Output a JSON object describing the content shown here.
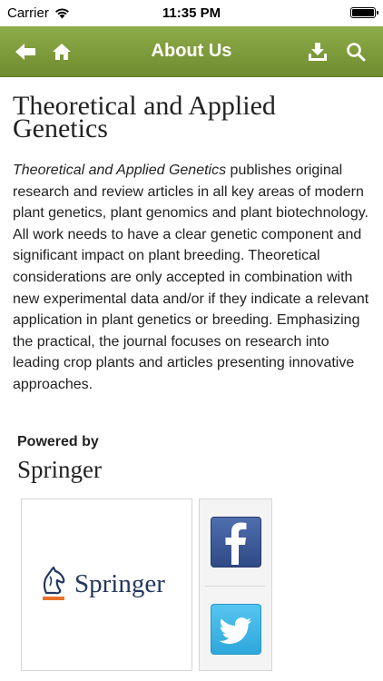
{
  "status_bar": {
    "carrier": "Carrier",
    "time": "11:35 PM"
  },
  "nav": {
    "title": "About Us",
    "icons": {
      "back": "back-arrow-icon",
      "home": "home-icon",
      "download": "download-icon",
      "search": "search-icon"
    },
    "color": "#7a9a37"
  },
  "journal": {
    "title": "Theoretical and Applied Genetics",
    "description_italic": "Theoretical and Applied Genetics",
    "description_rest": " publishes original research and review articles in all key areas of modern plant genetics, plant genomics and plant biotechnology. All work needs to have a clear genetic component and significant impact on plant breeding. Theoretical considerations are only accepted in combination with new experimental data and/or if they indicate a relevant application in plant genetics or breeding. Emphasizing the practical, the journal focuses on research into leading crop plants and articles presenting innovative approaches."
  },
  "powered_by": {
    "label": "Powered by",
    "publisher": "Springer",
    "logo_text": "Springer"
  },
  "social": {
    "facebook_icon": "facebook-icon",
    "twitter_icon": "twitter-icon",
    "facebook_color": "#3b5998",
    "twitter_color": "#3bb6e8"
  }
}
